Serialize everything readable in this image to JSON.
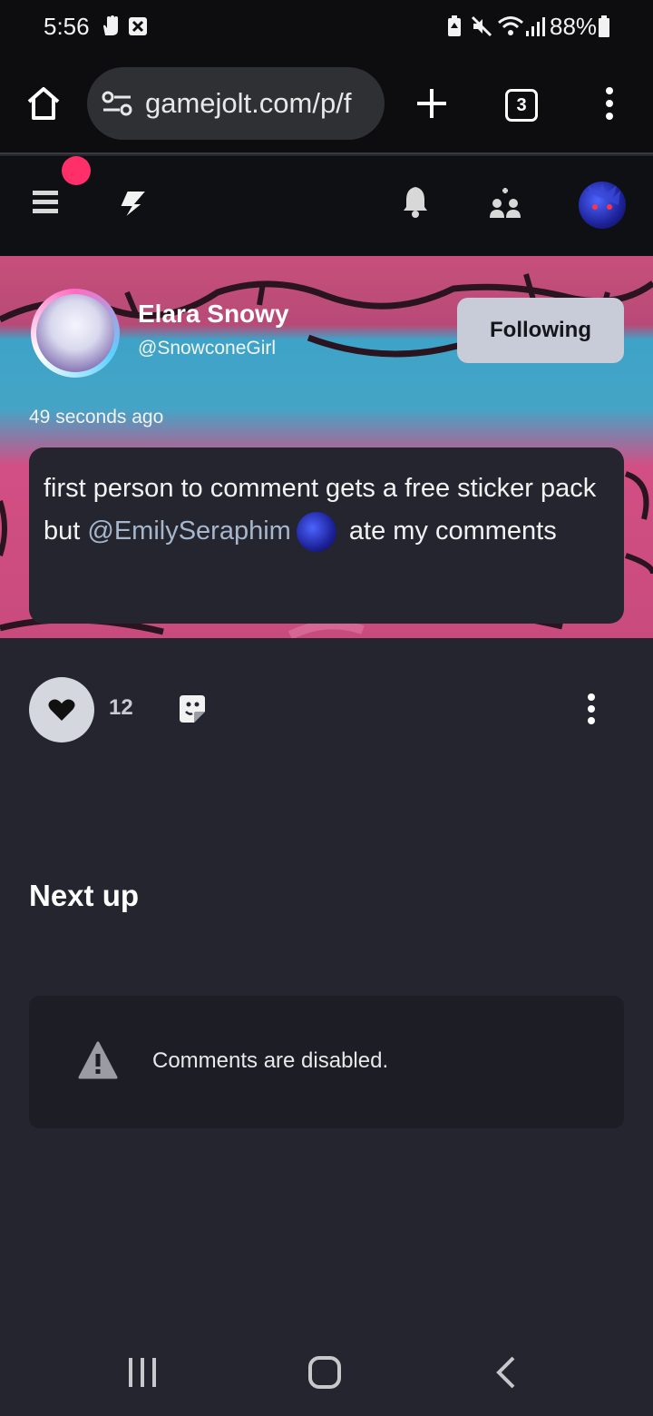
{
  "status_bar": {
    "time": "5:56",
    "battery": "88%",
    "icons": [
      "hand-icon",
      "close-box-icon",
      "battery-saver-icon",
      "mute-icon",
      "wifi-icon",
      "signal-icon",
      "battery-icon"
    ]
  },
  "browser": {
    "url": "gamejolt.com/p/f",
    "tab_count": "3",
    "icons": [
      "home-icon",
      "site-settings-icon",
      "new-tab-icon",
      "menu-dots-icon"
    ]
  },
  "site_header": {
    "icons": [
      "hamburger-menu-icon",
      "gamejolt-logo-icon",
      "bell-icon",
      "friend-request-icon",
      "user-avatar"
    ]
  },
  "post": {
    "author_name": "Elara Snowy",
    "author_handle": "@SnowconeGirl",
    "follow_label": "Following",
    "time_ago": "49 seconds ago",
    "text_before": "first person to comment gets a free sticker pack but ",
    "mention": "@EmilySeraphim",
    "text_after": " ate my comments",
    "like_count": "12"
  },
  "next_up": {
    "heading": "Next up"
  },
  "comments": {
    "message": "Comments are disabled."
  },
  "colors": {
    "page_bg": "#24252f",
    "notification_dot": "#ff2f6a",
    "follow_button_bg": "#c7ccd8",
    "mention": "#a6b6cc"
  }
}
